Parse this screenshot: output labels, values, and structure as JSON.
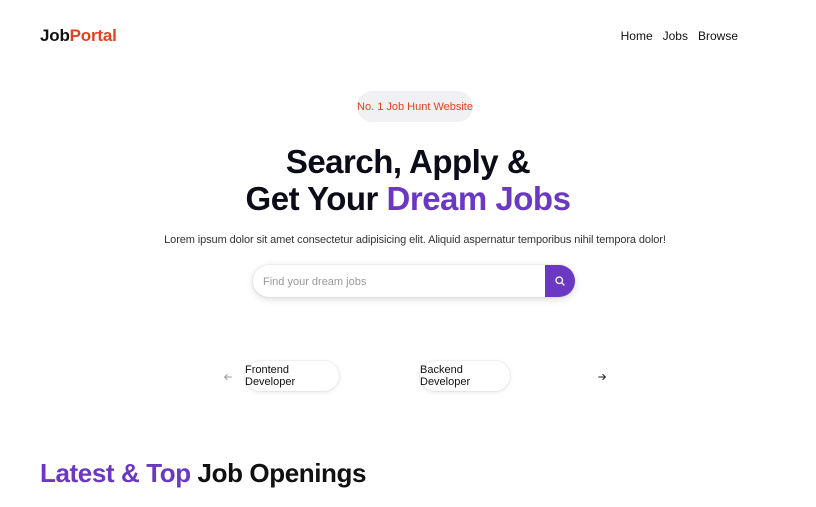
{
  "navbar": {
    "logo_prefix": "Job",
    "logo_accent": "Portal",
    "links": [
      "Home",
      "Jobs",
      "Browse"
    ]
  },
  "hero": {
    "badge": "No. 1 Job Hunt Website",
    "headline_line1": "Search, Apply &",
    "headline_line2_prefix": "Get Your ",
    "headline_line2_accent": "Dream Jobs",
    "subtitle": "Lorem ipsum dolor sit amet consectetur adipisicing elit. Aliquid aspernatur temporibus nihil tempora dolor!"
  },
  "search": {
    "placeholder": "Find your dream jobs",
    "value": ""
  },
  "categories": {
    "items": [
      "Frontend Developer",
      "Backend Developer"
    ],
    "prev_icon": "arrow-left-icon",
    "next_icon": "arrow-right-icon"
  },
  "latest_jobs": {
    "title_accent": "Latest & Top",
    "title_rest": " Job Openings"
  },
  "colors": {
    "brand_purple": "#6a38c2",
    "accent_red": "#e0431f"
  }
}
